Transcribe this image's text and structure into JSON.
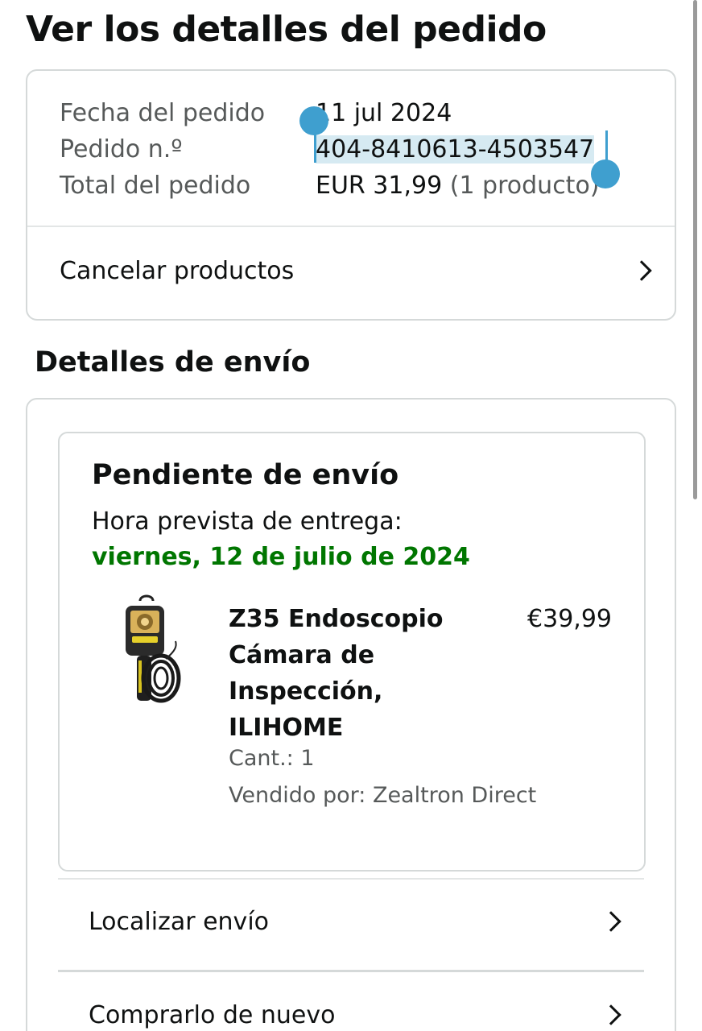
{
  "page": {
    "title": "Ver los detalles del pedido"
  },
  "order": {
    "date_label": "Fecha del pedido",
    "date_value": "11 jul 2024",
    "number_label": "Pedido n.º",
    "number_value": "404-8410613-4503547",
    "total_label": "Total del pedido",
    "total_amount": "EUR 31,99",
    "total_items": "(1 producto)",
    "cancel_label": "Cancelar productos"
  },
  "shipping": {
    "section_title": "Detalles de envío",
    "status": "Pendiente de envío",
    "eta_label": "Hora prevista de entrega:",
    "eta_date": "viernes, 12 de julio de 2024",
    "product": {
      "name": "Z35 Endoscopio Cámara de Inspección, ILIHOME",
      "price": "€39,99",
      "qty": "Cant.: 1",
      "seller": "Vendido por: Zealtron Direct",
      "image_icon": "endoscope-camera-image"
    },
    "track_label": "Localizar envío",
    "buy_again_label": "Comprarlo de nuevo"
  },
  "colors": {
    "eta_green": "#007600",
    "selection_blue": "#3f9fcf",
    "selection_bg": "#d6eaf2",
    "border": "#d5d9d9"
  }
}
